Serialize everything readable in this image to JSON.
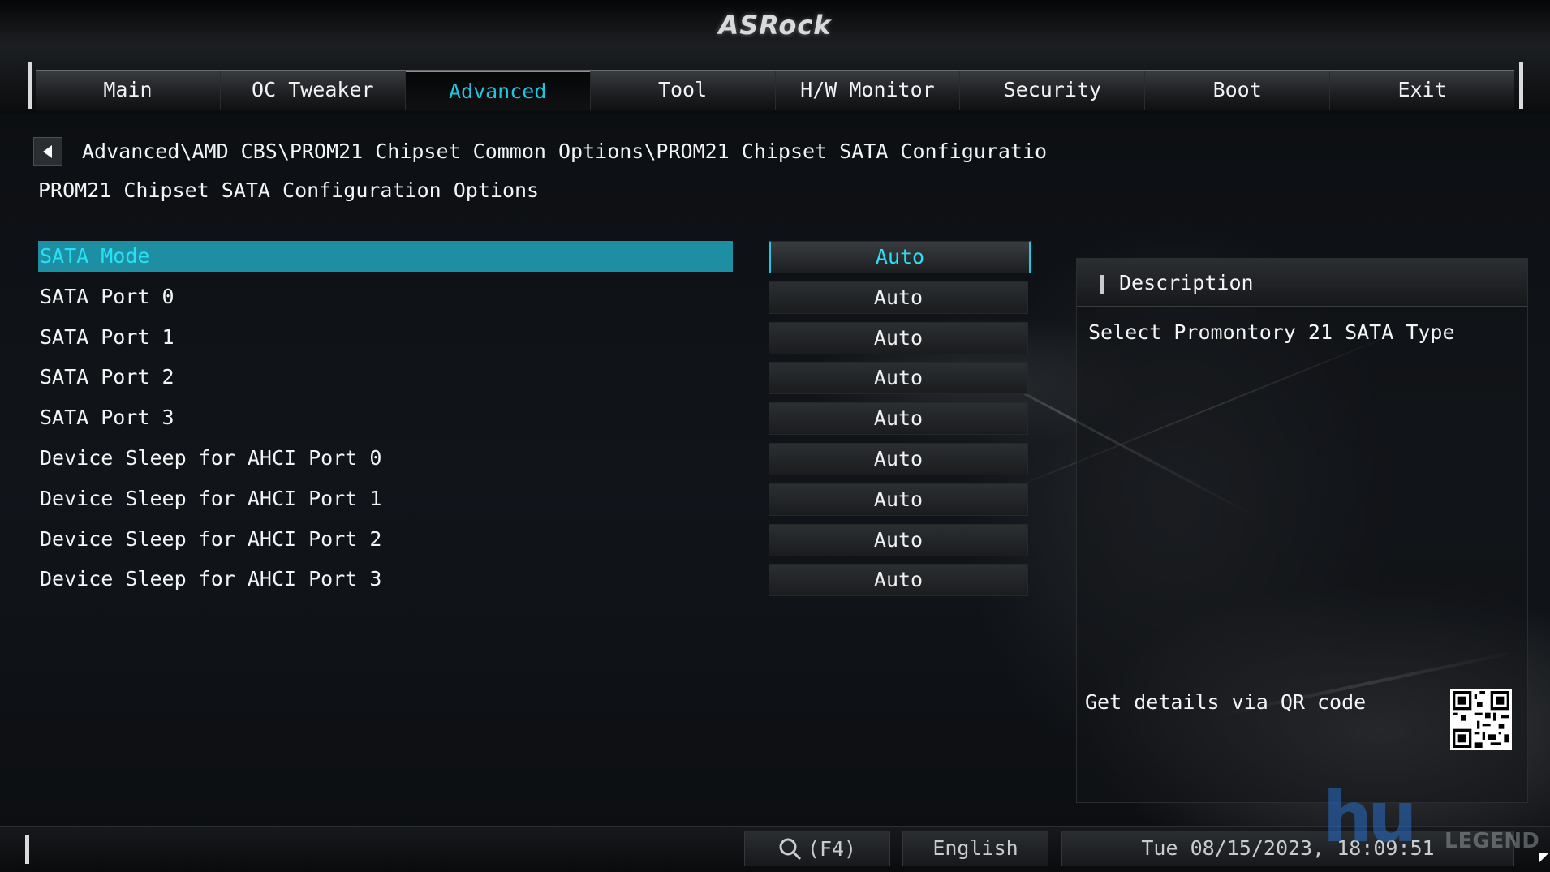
{
  "header": {
    "logo": "ASRock",
    "tabs": [
      {
        "label": "Main"
      },
      {
        "label": "OC Tweaker"
      },
      {
        "label": "Advanced",
        "active": true
      },
      {
        "label": "Tool"
      },
      {
        "label": "H/W Monitor"
      },
      {
        "label": "Security"
      },
      {
        "label": "Boot"
      },
      {
        "label": "Exit"
      }
    ]
  },
  "breadcrumb": "Advanced\\AMD CBS\\PROM21 Chipset Common Options\\PROM21 Chipset SATA Configuratio",
  "page_title": "PROM21 Chipset SATA Configuration Options",
  "settings": [
    {
      "label": "SATA Mode",
      "value": "Auto",
      "selected": true
    },
    {
      "label": "SATA Port 0",
      "value": "Auto"
    },
    {
      "label": "SATA Port 1",
      "value": "Auto"
    },
    {
      "label": "SATA Port 2",
      "value": "Auto"
    },
    {
      "label": "SATA Port 3",
      "value": "Auto"
    },
    {
      "label": "Device Sleep for AHCI Port 0",
      "value": "Auto"
    },
    {
      "label": "Device Sleep for AHCI Port 1",
      "value": "Auto"
    },
    {
      "label": "Device Sleep for AHCI Port 2",
      "value": "Auto"
    },
    {
      "label": "Device Sleep for AHCI Port 3",
      "value": "Auto"
    }
  ],
  "description": {
    "title": "Description",
    "text": "Select Promontory 21 SATA Type",
    "qr_label": "Get details via QR code"
  },
  "footer": {
    "search_label": "(F4)",
    "language": "English",
    "datetime": "Tue 08/15/2023, 18:09:51"
  },
  "watermark": {
    "text": "hu",
    "sub": "LEGEND"
  },
  "colors": {
    "accent": "#27e0f5",
    "selected_row": "#1e8ea3"
  }
}
